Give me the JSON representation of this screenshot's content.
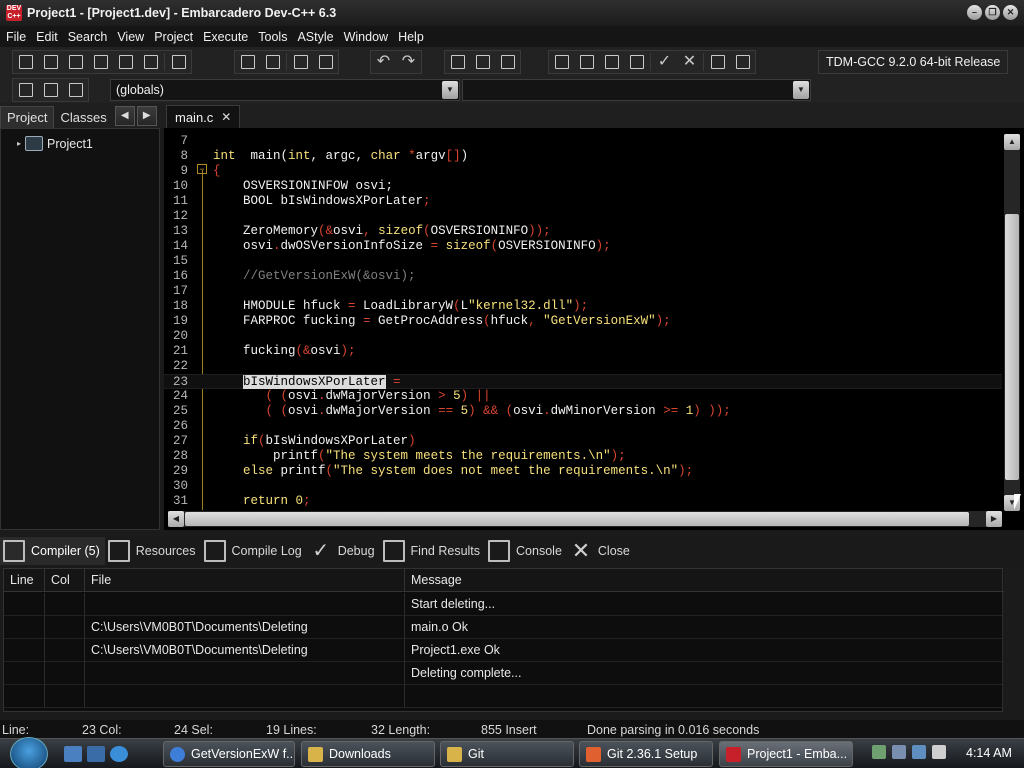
{
  "window": {
    "title": "Project1 - [Project1.dev] - Embarcadero Dev-C++ 6.3",
    "controls": [
      "minimize",
      "restore",
      "close"
    ]
  },
  "menu": [
    "File",
    "Edit",
    "Search",
    "View",
    "Project",
    "Execute",
    "Tools",
    "AStyle",
    "Window",
    "Help"
  ],
  "toolbar": {
    "compiler": "TDM-GCC 9.2.0 64-bit Release",
    "scope_combo": "(globals)",
    "symbol_combo": ""
  },
  "left_panel": {
    "tabs": [
      "Project",
      "Classes"
    ],
    "active_tab": "Project",
    "tree_root": "Project1"
  },
  "editor": {
    "tab": "main.c",
    "lines": [
      {
        "n": "7",
        "tokens": []
      },
      {
        "n": "8",
        "tokens": [
          [
            "kw",
            "int"
          ],
          [
            "",
            "  main("
          ],
          [
            "kw",
            "int"
          ],
          [
            "",
            ", argc, "
          ],
          [
            "kw",
            "char"
          ],
          [
            "op",
            " *"
          ],
          [
            "",
            "argv"
          ],
          [
            "op",
            "[]"
          ],
          [
            "",
            ")"
          ]
        ]
      },
      {
        "n": "9",
        "tokens": [
          [
            "op",
            "{"
          ]
        ]
      },
      {
        "n": "10",
        "tokens": [
          [
            "",
            "    OSVERSIONINFOW osvi;"
          ]
        ]
      },
      {
        "n": "11",
        "tokens": [
          [
            "",
            "    BOOL bIsWindowsXPorLater"
          ],
          [
            "op",
            ";"
          ]
        ]
      },
      {
        "n": "12",
        "tokens": []
      },
      {
        "n": "13",
        "tokens": [
          [
            "",
            "    ZeroMemory"
          ],
          [
            "op",
            "(&"
          ],
          [
            "",
            "osvi"
          ],
          [
            "op",
            ", "
          ],
          [
            "kw",
            "sizeof"
          ],
          [
            "op",
            "("
          ],
          [
            "",
            "OSVERSIONINFO"
          ],
          [
            "op",
            "));"
          ]
        ]
      },
      {
        "n": "14",
        "tokens": [
          [
            "",
            "    osvi"
          ],
          [
            "op",
            "."
          ],
          [
            "",
            "dwOSVersionInfoSize "
          ],
          [
            "op",
            "= "
          ],
          [
            "kw",
            "sizeof"
          ],
          [
            "op",
            "("
          ],
          [
            "",
            "OSVERSIONINFO"
          ],
          [
            "op",
            ");"
          ]
        ]
      },
      {
        "n": "15",
        "tokens": []
      },
      {
        "n": "16",
        "tokens": [
          [
            "cmt",
            "    //GetVersionExW(&osvi);"
          ]
        ]
      },
      {
        "n": "17",
        "tokens": []
      },
      {
        "n": "18",
        "tokens": [
          [
            "",
            "    HMODULE hfuck "
          ],
          [
            "op",
            "= "
          ],
          [
            "",
            "LoadLibraryW"
          ],
          [
            "op",
            "("
          ],
          [
            "",
            "L"
          ],
          [
            "str",
            "\"kernel32.dll\""
          ],
          [
            "op",
            ");"
          ]
        ]
      },
      {
        "n": "19",
        "tokens": [
          [
            "",
            "    FARPROC fucking "
          ],
          [
            "op",
            "= "
          ],
          [
            "",
            "GetProcAddress"
          ],
          [
            "op",
            "("
          ],
          [
            "",
            "hfuck"
          ],
          [
            "op",
            ", "
          ],
          [
            "str",
            "\"GetVersionExW\""
          ],
          [
            "op",
            ");"
          ]
        ]
      },
      {
        "n": "20",
        "tokens": []
      },
      {
        "n": "21",
        "tokens": [
          [
            "",
            "    fucking"
          ],
          [
            "op",
            "(&"
          ],
          [
            "",
            "osvi"
          ],
          [
            "op",
            ");"
          ]
        ]
      },
      {
        "n": "22",
        "tokens": []
      },
      {
        "n": "23",
        "tokens": [
          [
            "",
            "    "
          ],
          [
            "sel",
            "bIsWindowsXPorLater"
          ],
          [
            "op",
            " ="
          ]
        ]
      },
      {
        "n": "24",
        "tokens": [
          [
            "op",
            "       ( ("
          ],
          [
            "",
            "osvi"
          ],
          [
            "op",
            "."
          ],
          [
            "",
            "dwMajorVersion "
          ],
          [
            "op",
            "> "
          ],
          [
            "num",
            "5"
          ],
          [
            "op",
            ") ||"
          ]
        ]
      },
      {
        "n": "25",
        "tokens": [
          [
            "op",
            "       ( ("
          ],
          [
            "",
            "osvi"
          ],
          [
            "op",
            "."
          ],
          [
            "",
            "dwMajorVersion "
          ],
          [
            "op",
            "== "
          ],
          [
            "num",
            "5"
          ],
          [
            "op",
            ") && ("
          ],
          [
            "",
            "osvi"
          ],
          [
            "op",
            "."
          ],
          [
            "",
            "dwMinorVersion "
          ],
          [
            "op",
            ">= "
          ],
          [
            "num",
            "1"
          ],
          [
            "op",
            ") ));"
          ]
        ]
      },
      {
        "n": "26",
        "tokens": []
      },
      {
        "n": "27",
        "tokens": [
          [
            "kw",
            "    if"
          ],
          [
            "op",
            "("
          ],
          [
            "",
            "bIsWindowsXPorLater"
          ],
          [
            "op",
            ")"
          ]
        ]
      },
      {
        "n": "28",
        "tokens": [
          [
            "",
            "        printf"
          ],
          [
            "op",
            "("
          ],
          [
            "str",
            "\"The system meets the requirements.\\n\""
          ],
          [
            "op",
            ");"
          ]
        ]
      },
      {
        "n": "29",
        "tokens": [
          [
            "kw",
            "    else "
          ],
          [
            "",
            "printf"
          ],
          [
            "op",
            "("
          ],
          [
            "str",
            "\"The system does not meet the requirements.\\n\""
          ],
          [
            "op",
            ");"
          ]
        ]
      },
      {
        "n": "30",
        "tokens": []
      },
      {
        "n": "31",
        "tokens": [
          [
            "kw",
            "    return "
          ],
          [
            "num",
            "0"
          ],
          [
            "op",
            ";"
          ]
        ]
      }
    ]
  },
  "bottom_panel": {
    "tabs": [
      {
        "label": "Compiler (5)",
        "icon": "grid-icon"
      },
      {
        "label": "Resources",
        "icon": "resources-icon"
      },
      {
        "label": "Compile Log",
        "icon": "chart-icon"
      },
      {
        "label": "Debug",
        "icon": "check-icon"
      },
      {
        "label": "Find Results",
        "icon": "find-icon"
      },
      {
        "label": "Console",
        "icon": "console-icon"
      },
      {
        "label": "Close",
        "icon": "close-icon"
      }
    ],
    "columns": [
      "Line",
      "Col",
      "File",
      "Message"
    ],
    "rows": [
      {
        "line": "",
        "col": "",
        "file": "",
        "message": "Start deleting..."
      },
      {
        "line": "",
        "col": "",
        "file": "C:\\Users\\VM0B0T\\Documents\\Deleting",
        "message": "main.o Ok"
      },
      {
        "line": "",
        "col": "",
        "file": "C:\\Users\\VM0B0T\\Documents\\Deleting",
        "message": "Project1.exe Ok"
      },
      {
        "line": "",
        "col": "",
        "file": "",
        "message": "Deleting complete..."
      },
      {
        "line": "",
        "col": "",
        "file": "",
        "message": ""
      }
    ]
  },
  "status_bar": {
    "line": "Line:",
    "col": "23 Col:",
    "sel": "24 Sel:",
    "lines": "19 Lines:",
    "length": "32 Length:",
    "insert": "855  Insert",
    "message": "Done parsing in 0.016 seconds"
  },
  "taskbar": {
    "tasks": [
      {
        "label": "GetVersionExW f...",
        "icon_color": "#3d7fd8"
      },
      {
        "label": "Downloads",
        "icon_color": "#d8b34a"
      },
      {
        "label": "Git",
        "icon_color": "#d8b34a"
      },
      {
        "label": "Git 2.36.1 Setup",
        "icon_color": "#e06030"
      },
      {
        "label": "Project1 - Emba...",
        "icon_color": "#c8202a"
      }
    ],
    "clock": "4:14 AM"
  },
  "colors": {
    "keyword": "#f7e07a",
    "operator": "#d9452f",
    "comment": "#808080",
    "background": "#000000"
  }
}
